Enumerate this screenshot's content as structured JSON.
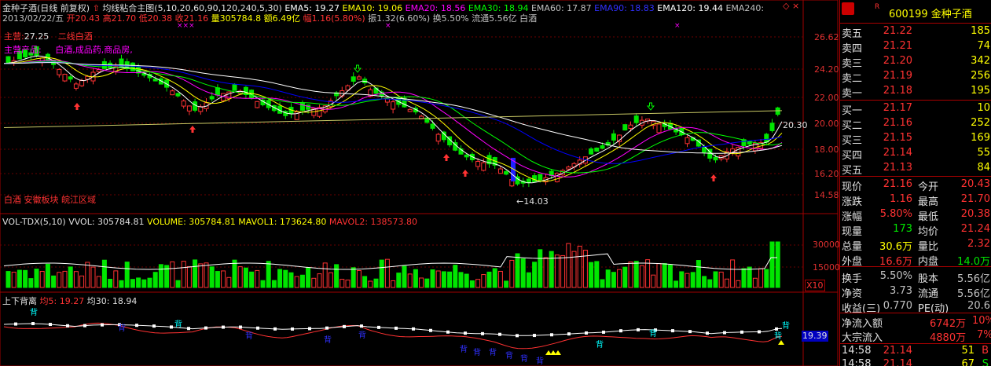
{
  "colors": {
    "up": "#ff3232",
    "down": "#00e600",
    "bg": "#000000",
    "grid": "#8b0000",
    "ema5": "#ffffff",
    "ema10": "#ffff00",
    "ema20": "#ff00ff",
    "ema30": "#00ff00",
    "ema60": "#808080",
    "ema90": "#0000ff",
    "ema120": "#ffffff",
    "label_yellow": "#ffff00",
    "label_cyan": "#00ffff",
    "label_magenta": "#ff00ff"
  },
  "main_header": {
    "stock": "金种子酒(日线 前复权)",
    "indicator": "均线粘合主图(5,10,20,60,90,120,240,5,30)",
    "ema5": "EMA5: 19.27",
    "ema10": "EMA10: 19.06",
    "ema20": "EMA20: 18.56",
    "ema30": "EMA30: 18.94",
    "ema60": "EMA60: 17.87",
    "ema90": "EMA90: 18.83",
    "ema120": "EMA120: 19.44",
    "ema240": "EMA240:"
  },
  "date_line": {
    "date": "2013/02/22/五",
    "open": "开20.43",
    "high": "高21.70",
    "low": "低20.38",
    "close": "收21.16",
    "volume": "量305784.8",
    "amount": "额6.49亿",
    "change": "幅1.16(5.80%)",
    "amplitude": "振1.32(6.60%)",
    "turnover": "换5.50%",
    "float": "流通5.56亿",
    "sector": "白酒"
  },
  "overlay_labels": {
    "main_biz_label": "主营:",
    "main_biz_val": "27.25",
    "main_biz_text": "二线白酒",
    "product_label": "主营产品:",
    "product_text": "白酒,成品药,商品房,",
    "region": "白酒 安徽板块 皖江区域",
    "low_price": "←14.03",
    "right_price": "20.30",
    "star_marks": "×××"
  },
  "price_axis": [
    "26.62",
    "24.20",
    "22.00",
    "20.00",
    "18.00",
    "16.20",
    "14.58"
  ],
  "vol_header": {
    "name": "VOL-TDX(5,10)",
    "vvol": "VVOL: 305784.81",
    "volume": "VOLUME: 305784.81",
    "mavol1": "MAVOL1: 173624.80",
    "mavol2": "MAVOL2: 138573.80"
  },
  "vol_axis": [
    "30000",
    "15000"
  ],
  "vol_unit": "X10",
  "div_header": {
    "name": "上下背离",
    "ma5": "均5: 19.27",
    "ma30": "均30: 18.94"
  },
  "div_axis_val": "19.39",
  "div_mark": "背",
  "quote": {
    "code": "600199",
    "name": "金种子酒",
    "r_mark": "R",
    "asks": [
      {
        "label": "卖五",
        "price": "21.22",
        "vol": "185"
      },
      {
        "label": "卖四",
        "price": "21.21",
        "vol": "74"
      },
      {
        "label": "卖三",
        "price": "21.20",
        "vol": "342"
      },
      {
        "label": "卖二",
        "price": "21.19",
        "vol": "256"
      },
      {
        "label": "卖一",
        "price": "21.18",
        "vol": "195"
      }
    ],
    "bids": [
      {
        "label": "买一",
        "price": "21.17",
        "vol": "10"
      },
      {
        "label": "买二",
        "price": "21.16",
        "vol": "252"
      },
      {
        "label": "买三",
        "price": "21.15",
        "vol": "169"
      },
      {
        "label": "买四",
        "price": "21.14",
        "vol": "55"
      },
      {
        "label": "买五",
        "price": "21.13",
        "vol": "84"
      }
    ],
    "stats": [
      {
        "l1": "现价",
        "v1": "21.16",
        "c1": "#ff3232",
        "l2": "今开",
        "v2": "20.43",
        "c2": "#ff3232"
      },
      {
        "l1": "涨跌",
        "v1": "1.16",
        "c1": "#ff3232",
        "l2": "最高",
        "v2": "21.70",
        "c2": "#ff3232"
      },
      {
        "l1": "涨幅",
        "v1": "5.80%",
        "c1": "#ff3232",
        "l2": "最低",
        "v2": "20.38",
        "c2": "#ff3232"
      },
      {
        "l1": "现量",
        "v1": "173",
        "c1": "#00e600",
        "l2": "均价",
        "v2": "21.24",
        "c2": "#ff3232"
      },
      {
        "l1": "总量",
        "v1": "30.6万",
        "c1": "#ffff00",
        "l2": "量比",
        "v2": "2.32",
        "c2": "#ff3232"
      },
      {
        "l1": "外盘",
        "v1": "16.6万",
        "c1": "#ff3232",
        "l2": "内盘",
        "v2": "14.0万",
        "c2": "#00e600"
      },
      {
        "l1": "换手",
        "v1": "5.50%",
        "c1": "#c0c0c0",
        "l2": "股本",
        "v2": "5.56亿",
        "c2": "#c0c0c0"
      },
      {
        "l1": "净资",
        "v1": "3.73",
        "c1": "#c0c0c0",
        "l2": "流通",
        "v2": "5.56亿",
        "c2": "#c0c0c0"
      },
      {
        "l1": "收益(三)",
        "v1": "0.770",
        "c1": "#c0c0c0",
        "l2": "PE(动)",
        "v2": "20.6",
        "c2": "#c0c0c0"
      }
    ],
    "netflow_label": "净流入额",
    "netflow_val": "6742万",
    "netflow_pct": "10%",
    "bigflow_label": "大宗流入",
    "bigflow_val": "4880万",
    "bigflow_pct": "7%",
    "ticks": [
      {
        "time": "14:58",
        "price": "21.14",
        "vol": "51",
        "side": "B"
      },
      {
        "time": "14:58",
        "price": "21.14",
        "vol": "67",
        "side": "S"
      }
    ]
  }
}
